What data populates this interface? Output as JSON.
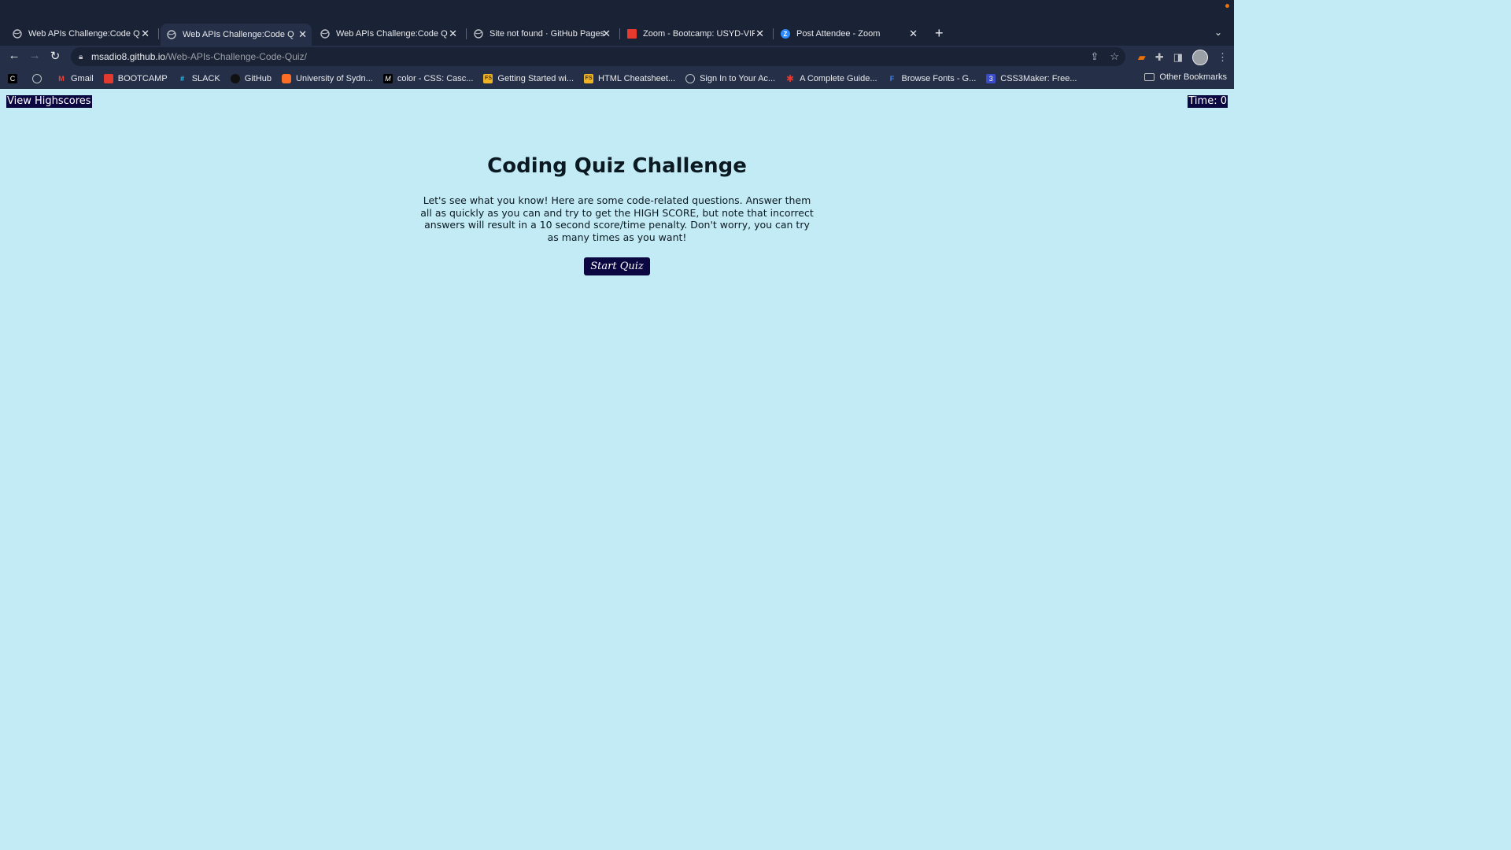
{
  "browser": {
    "tabs": [
      {
        "title": "Web APIs Challenge:Code Quiz",
        "active": false,
        "icon": "globe-icon"
      },
      {
        "title": "Web APIs Challenge:Code Quiz",
        "active": true,
        "icon": "globe-icon"
      },
      {
        "title": "Web APIs Challenge:Code Quiz",
        "active": false,
        "icon": "globe-icon"
      },
      {
        "title": "Site not found · GitHub Pages",
        "active": false,
        "icon": "globe-icon"
      },
      {
        "title": "Zoom - Bootcamp: USYD-VIRT",
        "active": false,
        "icon": "zoom-icon"
      },
      {
        "title": "Post Attendee - Zoom",
        "active": false,
        "icon": "zoom-z-icon"
      }
    ],
    "url": {
      "host": "msadio8.github.io",
      "path": "/Web-APIs-Challenge-Code-Quiz/"
    },
    "bookmarks": [
      {
        "label": "",
        "icon": "c-icon"
      },
      {
        "label": "",
        "icon": "globe-icon"
      },
      {
        "label": "Gmail",
        "icon": "gmail-icon"
      },
      {
        "label": "BOOTCAMP",
        "icon": "bootcamp-icon"
      },
      {
        "label": "SLACK",
        "icon": "slack-icon"
      },
      {
        "label": "GitHub",
        "icon": "github-icon"
      },
      {
        "label": "University of Sydn...",
        "icon": "gitlab-icon"
      },
      {
        "label": "color - CSS: Casc...",
        "icon": "mdn-icon"
      },
      {
        "label": "Getting Started wi...",
        "icon": "js-icon"
      },
      {
        "label": "HTML Cheatsheet...",
        "icon": "js-icon"
      },
      {
        "label": "Sign In to Your Ac...",
        "icon": "globe-icon"
      },
      {
        "label": "A Complete Guide...",
        "icon": "star-icon"
      },
      {
        "label": "Browse Fonts - G...",
        "icon": "fonts-icon"
      },
      {
        "label": "CSS3Maker: Free...",
        "icon": "css-icon"
      }
    ],
    "other_bookmarks": "Other Bookmarks"
  },
  "page": {
    "highscores_link": "View Highscores",
    "timer": "Time: 0",
    "title": "Coding Quiz Challenge",
    "intro": "Let's see what you know! Here are some code-related questions. Answer them all as quickly as you can and try to get the HIGH SCORE, but note that incorrect answers will result in a 10 second score/time penalty. Don't worry, you can try as many times as you want!",
    "start_button": "Start Quiz"
  },
  "colors": {
    "page_background": "#c3ebf5",
    "accent_dark": "#0b0740",
    "chrome_background": "#1a2235"
  }
}
